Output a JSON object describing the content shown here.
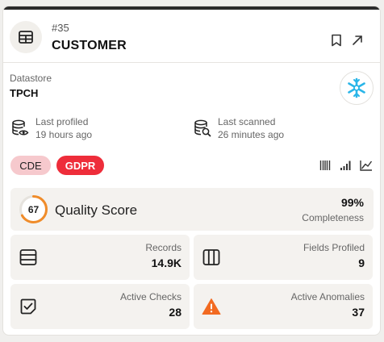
{
  "header": {
    "id": "#35",
    "name": "CUSTOMER",
    "icon": "table-icon",
    "actions": [
      "bookmark-icon",
      "open-external-icon"
    ]
  },
  "datastore": {
    "label": "Datastore",
    "name": "TPCH",
    "logo": "snowflake-icon",
    "logo_color": "#29b5e8"
  },
  "profiling": {
    "last_profiled_label": "Last profiled",
    "last_profiled_value": "19 hours ago",
    "last_scanned_label": "Last scanned",
    "last_scanned_value": "26 minutes ago"
  },
  "tags": [
    {
      "label": "CDE",
      "bg": "#f6c9cd"
    },
    {
      "label": "GDPR",
      "bg": "#ee2d3a"
    }
  ],
  "view_icons": [
    "barcode-icon",
    "signal-bars-icon",
    "line-chart-icon"
  ],
  "quality": {
    "score": "67",
    "score_fraction": 0.67,
    "label": "Quality Score",
    "ring_color": "#f08c2a",
    "completeness_value": "99%",
    "completeness_label": "Completeness"
  },
  "stats": [
    {
      "label": "Records",
      "value": "14.9K",
      "icon": "rows-icon"
    },
    {
      "label": "Fields Profiled",
      "value": "9",
      "icon": "columns-icon"
    },
    {
      "label": "Active Checks",
      "value": "28",
      "icon": "check-square-icon"
    },
    {
      "label": "Active Anomalies",
      "value": "37",
      "icon": "warning-triangle-icon",
      "icon_color": "#f26a21"
    }
  ]
}
